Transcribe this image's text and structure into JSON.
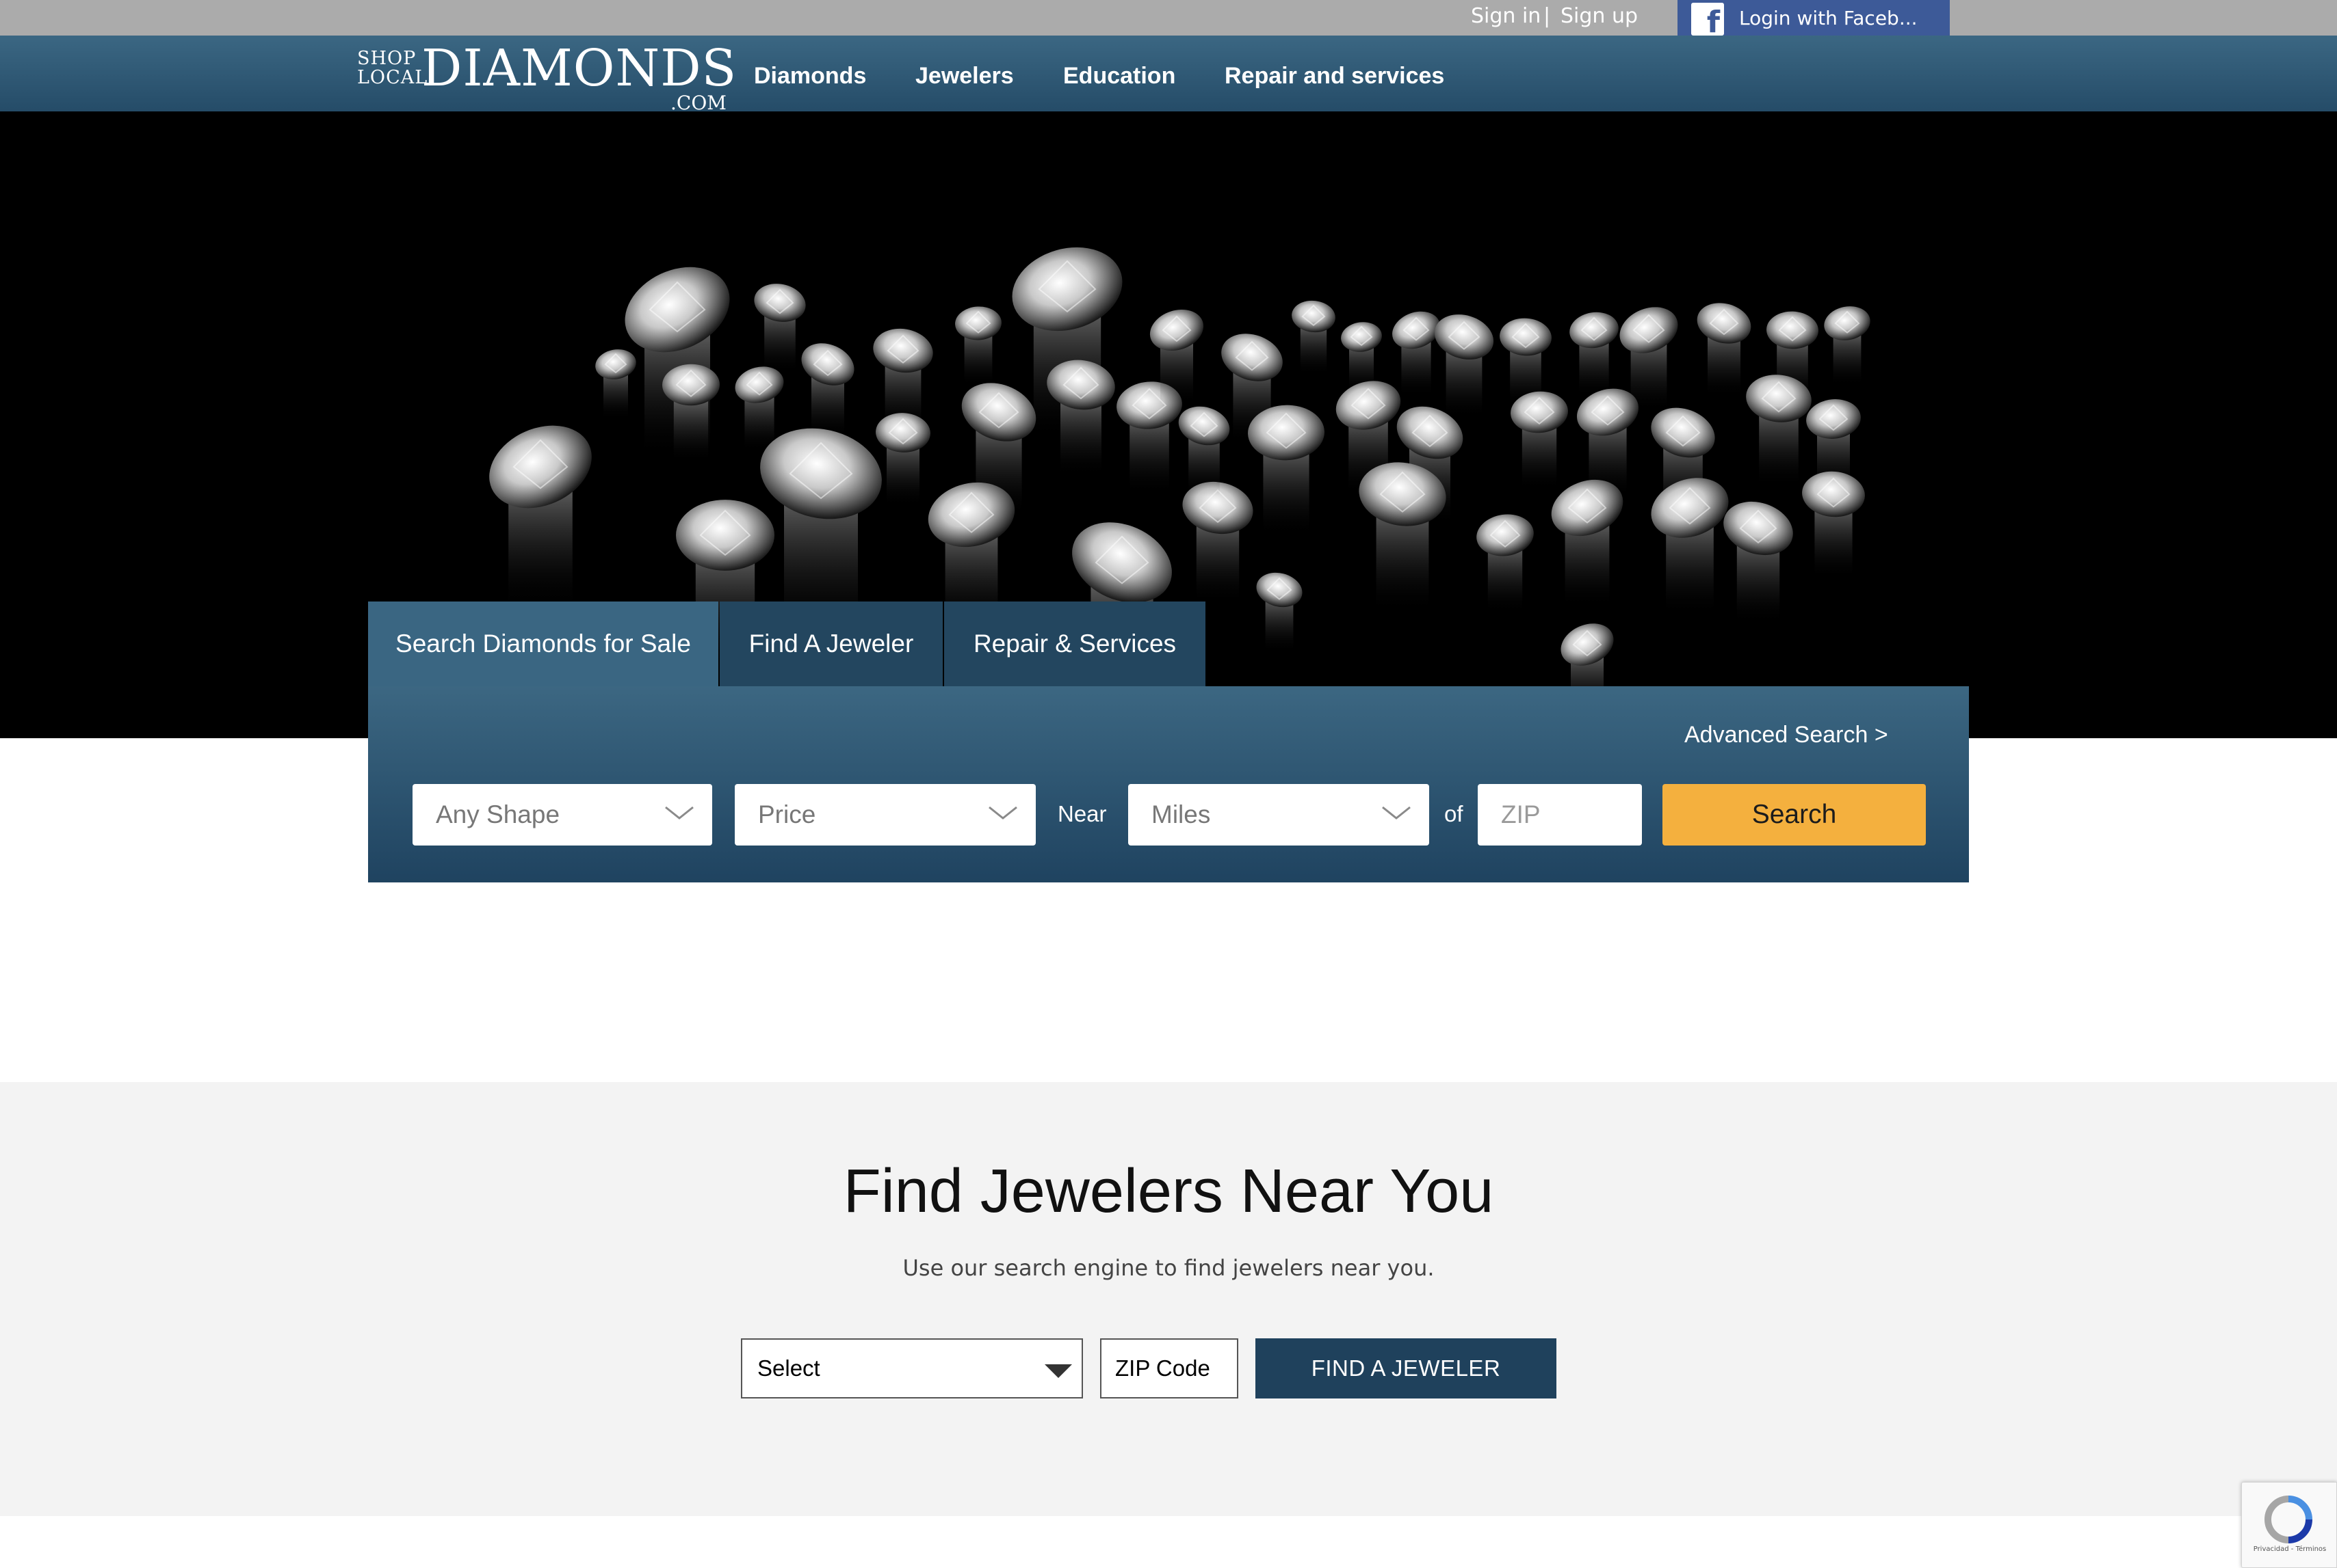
{
  "header": {
    "sign_in": "Sign in",
    "separator": "|",
    "sign_up": "Sign up",
    "facebook_login": "Login with Faceb..."
  },
  "logo": {
    "shop": "SHOP",
    "local": "LOCAL",
    "main": "DIAMONDS",
    "com": ".COM"
  },
  "nav": {
    "items": [
      "Diamonds",
      "Jewelers",
      "Education",
      "Repair and services"
    ]
  },
  "search": {
    "tabs": [
      "Search Diamonds for Sale",
      "Find A Jeweler",
      "Repair & Services"
    ],
    "active_tab": "Search Diamonds for Sale",
    "advanced": "Advanced Search >",
    "shape": "Any Shape",
    "price": "Price",
    "near": "Near",
    "miles": "Miles",
    "of": "of",
    "zip_placeholder": "ZIP",
    "button": "Search"
  },
  "find": {
    "title": "Find Jewelers Near You",
    "subtitle": "Use our search engine to find jewelers near you.",
    "select": "Select",
    "zip": "ZIP Code",
    "button": "FIND A JEWELER"
  },
  "recaptcha": {
    "links": "Privacidad - Términos"
  },
  "colors": {
    "nav": "#2f5a76",
    "search_button": "#f4b03e",
    "find_button": "#1f415c",
    "facebook": "#3d5a98"
  }
}
